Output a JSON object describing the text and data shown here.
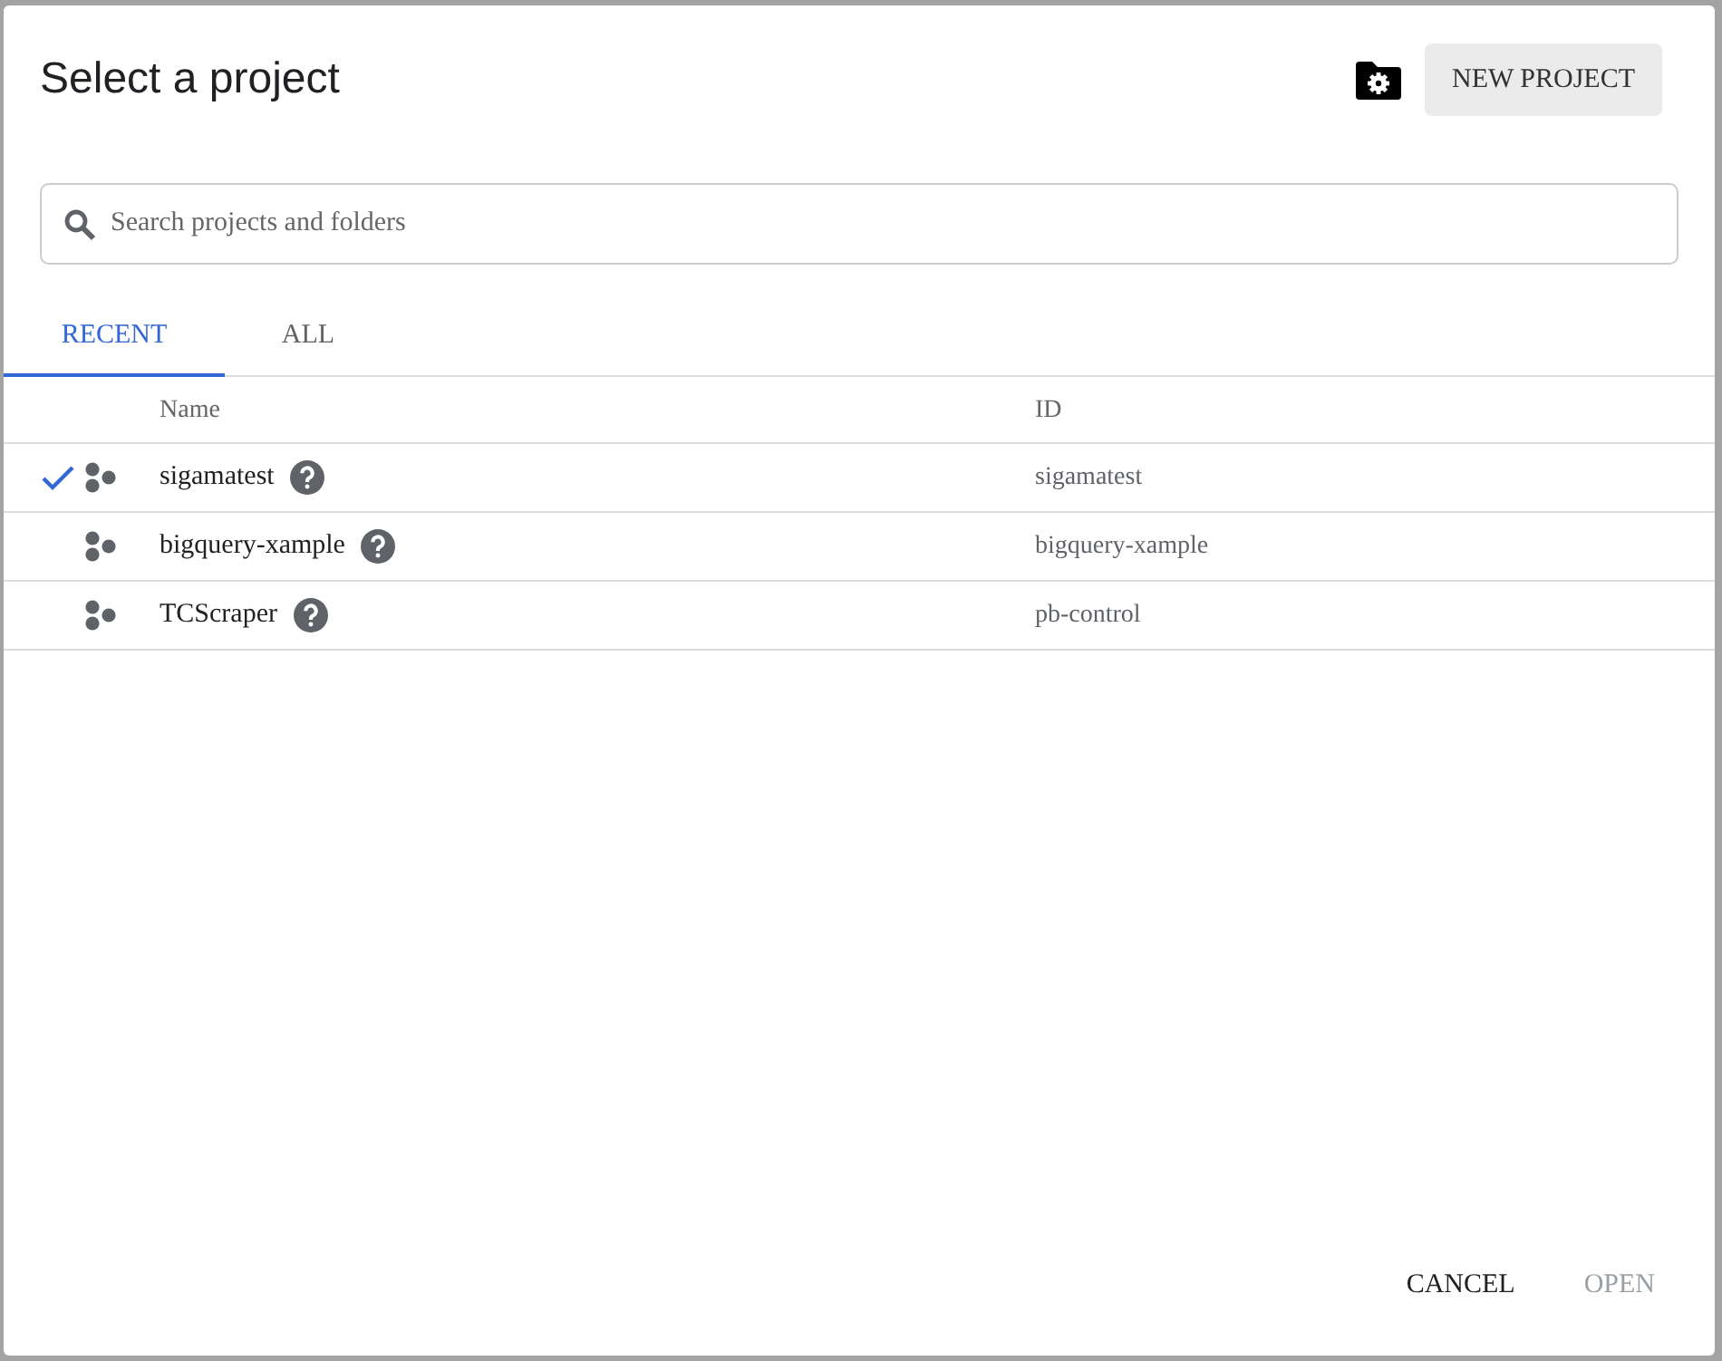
{
  "dialog": {
    "title": "Select a project",
    "new_project_button": "NEW PROJECT"
  },
  "search": {
    "placeholder": "Search projects and folders"
  },
  "tabs": [
    {
      "label": "RECENT",
      "selected": true
    },
    {
      "label": "ALL",
      "selected": false
    }
  ],
  "table": {
    "columns": [
      "Name",
      "ID"
    ],
    "rows": [
      {
        "name": "sigamatest",
        "id": "sigamatest",
        "selected": true
      },
      {
        "name": "bigquery-xample",
        "id": "bigquery-xample",
        "selected": false
      },
      {
        "name": "TCScraper",
        "id": "pb-control",
        "selected": false
      }
    ]
  },
  "buttons": [
    {
      "label": "CANCEL",
      "disabled": false
    },
    {
      "label": "OPEN",
      "disabled": true
    }
  ]
}
